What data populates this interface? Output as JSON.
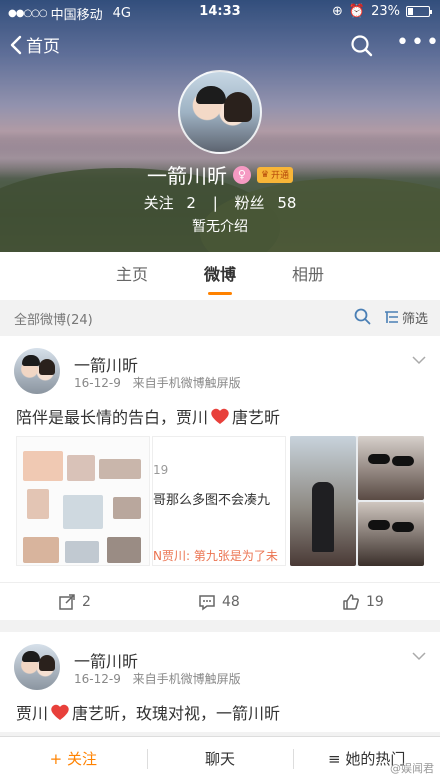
{
  "status": {
    "carrier": "中国移动",
    "network": "4G",
    "time": "14:33",
    "battery": "23%",
    "battery_level": 0.23
  },
  "nav": {
    "back_label": "首页"
  },
  "profile": {
    "name": "一箭川昕",
    "badge_open": "开通",
    "follow_label": "关注",
    "follow_count": "2",
    "separator": "|",
    "fans_label": "粉丝",
    "fans_count": "58",
    "intro": "暂无介绍"
  },
  "tabs": [
    "主页",
    "微博",
    "相册"
  ],
  "filter": {
    "label": "全部微博(24)",
    "filter_label": "筛选"
  },
  "posts": [
    {
      "name": "一箭川昕",
      "date": "16-12-9",
      "source": "来自手机微博触屏版",
      "text_before": "陪伴是最长情的告白，贾川",
      "text_after": "唐艺昕",
      "image_text": {
        "line1": "19",
        "line2": "哥那么多图不会凑九",
        "line3": "N贾川: 第九张是为了未"
      },
      "reposts": "2",
      "comments": "48",
      "likes": "19"
    },
    {
      "name": "一箭川昕",
      "date": "16-12-9",
      "source": "来自手机微博触屏版",
      "text_before": "贾川",
      "text_after": "唐艺昕，玫瑰对视，一箭川昕"
    }
  ],
  "bottom": {
    "follow": "+ 关注",
    "chat": "聊天",
    "hot": "≡ 她的热门"
  },
  "watermark": "@娱闻君",
  "colors": {
    "accent": "#ff8200",
    "heart": "#e8403b"
  }
}
